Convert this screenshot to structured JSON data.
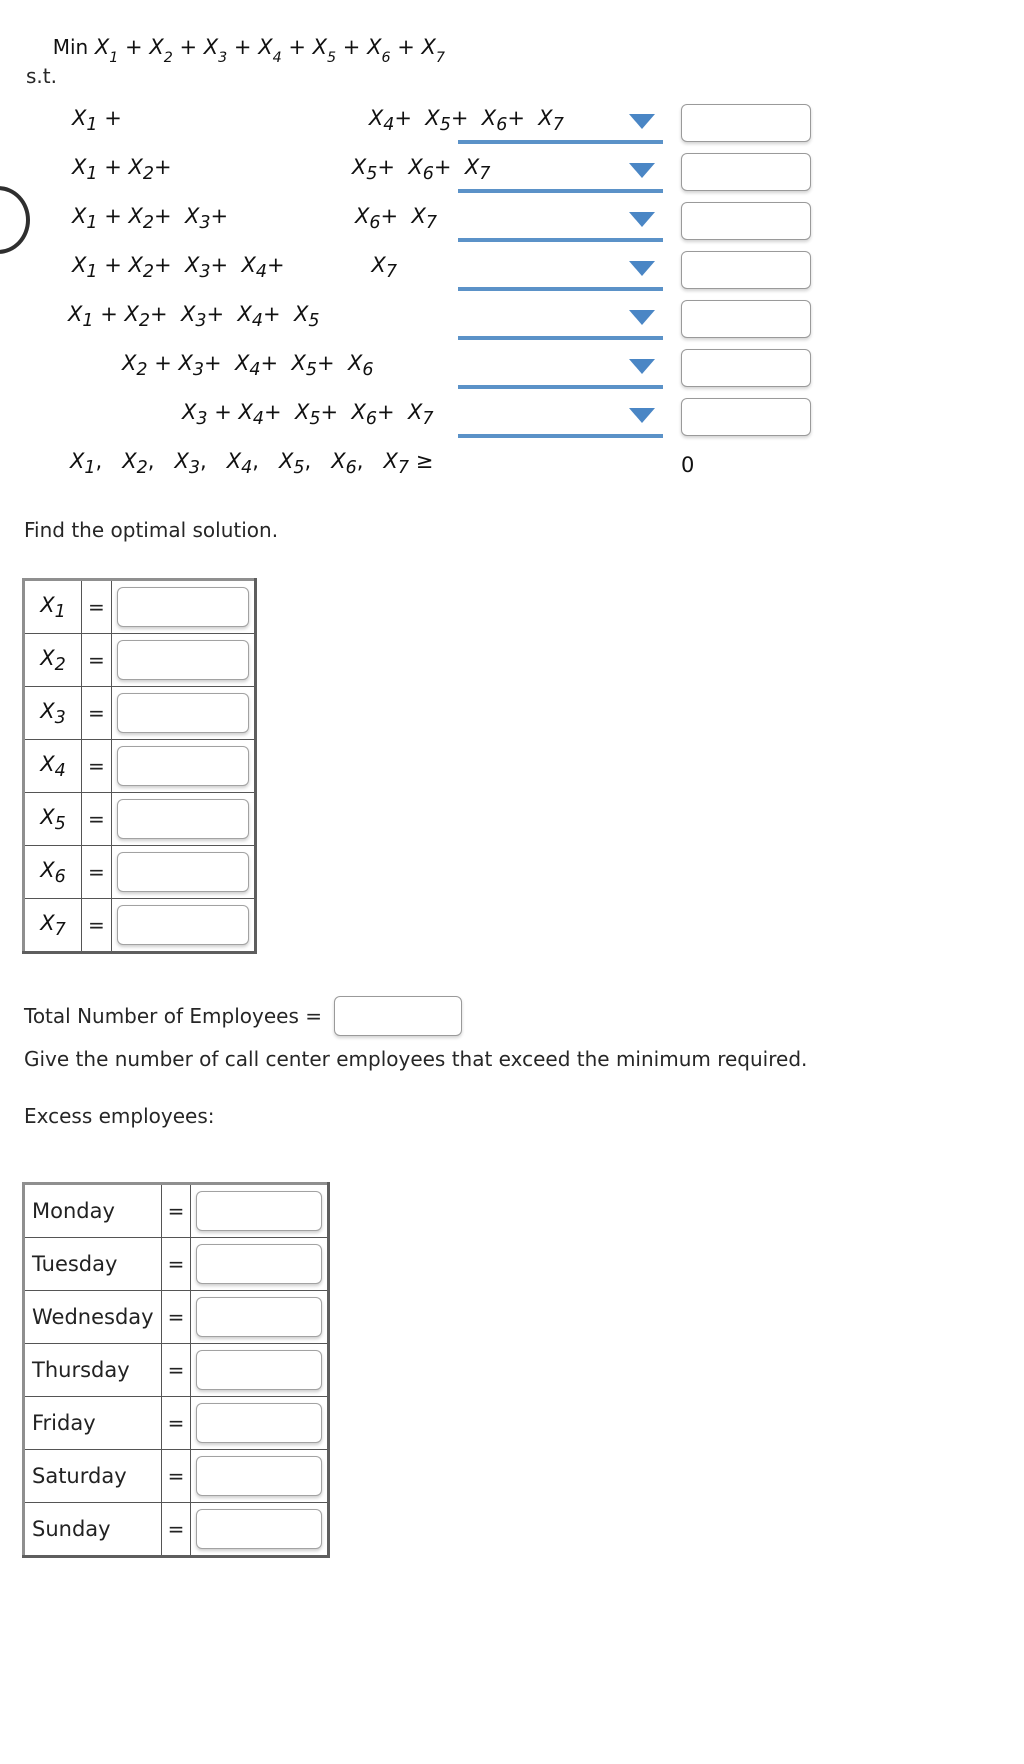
{
  "problem": {
    "objective_label": "Min",
    "objective_expr": "X1 + X2 + X3 + X4 + X5 + X6 + X7",
    "subject_to_label": "s.t.",
    "constraints": [
      {
        "expr": "X1 +            X4+  X5+  X6+  X7",
        "operator": "",
        "rhs": ""
      },
      {
        "expr": "X1 + X2+            X5+  X6+  X7",
        "operator": "",
        "rhs": ""
      },
      {
        "expr": "X1 + X2+  X3+           X6+  X7",
        "operator": "",
        "rhs": ""
      },
      {
        "expr": "X1 + X2+  X3+  X4+          X7",
        "operator": "",
        "rhs": ""
      },
      {
        "expr": "X1 + X2+  X3+  X4+  X5",
        "operator": "",
        "rhs": ""
      },
      {
        "expr": "X2 + X3+  X4+  X5+  X6",
        "operator": "",
        "rhs": ""
      },
      {
        "expr": "X3 + X4+  X5+  X6+  X7",
        "operator": "",
        "rhs": ""
      }
    ],
    "nonneg_expr": "X1,  X2,  X3,  X4,  X5,  X6,  X7 ≥",
    "nonneg_rhs": "0"
  },
  "prompts": {
    "find_optimal": "Find the optimal solution.",
    "total_employees_label": "Total Number of Employees  =",
    "excess_instruction": "Give the number of call center employees that exceed the minimum required.",
    "excess_label": "Excess employees:"
  },
  "solution_table": {
    "equals_sign": "=",
    "rows": [
      {
        "variable": "X",
        "subscript": "1",
        "value": ""
      },
      {
        "variable": "X",
        "subscript": "2",
        "value": ""
      },
      {
        "variable": "X",
        "subscript": "3",
        "value": ""
      },
      {
        "variable": "X",
        "subscript": "4",
        "value": ""
      },
      {
        "variable": "X",
        "subscript": "5",
        "value": ""
      },
      {
        "variable": "X",
        "subscript": "6",
        "value": ""
      },
      {
        "variable": "X",
        "subscript": "7",
        "value": ""
      }
    ]
  },
  "excess_table": {
    "equals_sign": "=",
    "rows": [
      {
        "day": "Monday",
        "value": ""
      },
      {
        "day": "Tuesday",
        "value": ""
      },
      {
        "day": "Wednesday",
        "value": ""
      },
      {
        "day": "Thursday",
        "value": ""
      },
      {
        "day": "Friday",
        "value": ""
      },
      {
        "day": "Saturday",
        "value": ""
      },
      {
        "day": "Sunday",
        "value": ""
      }
    ]
  },
  "total_employees": {
    "value": ""
  },
  "icons": {
    "dropdown_arrow": "chevron-down-icon"
  },
  "colors": {
    "dropdown_accent": "#5b92c8",
    "text": "#262626",
    "table_border": "#555555"
  }
}
